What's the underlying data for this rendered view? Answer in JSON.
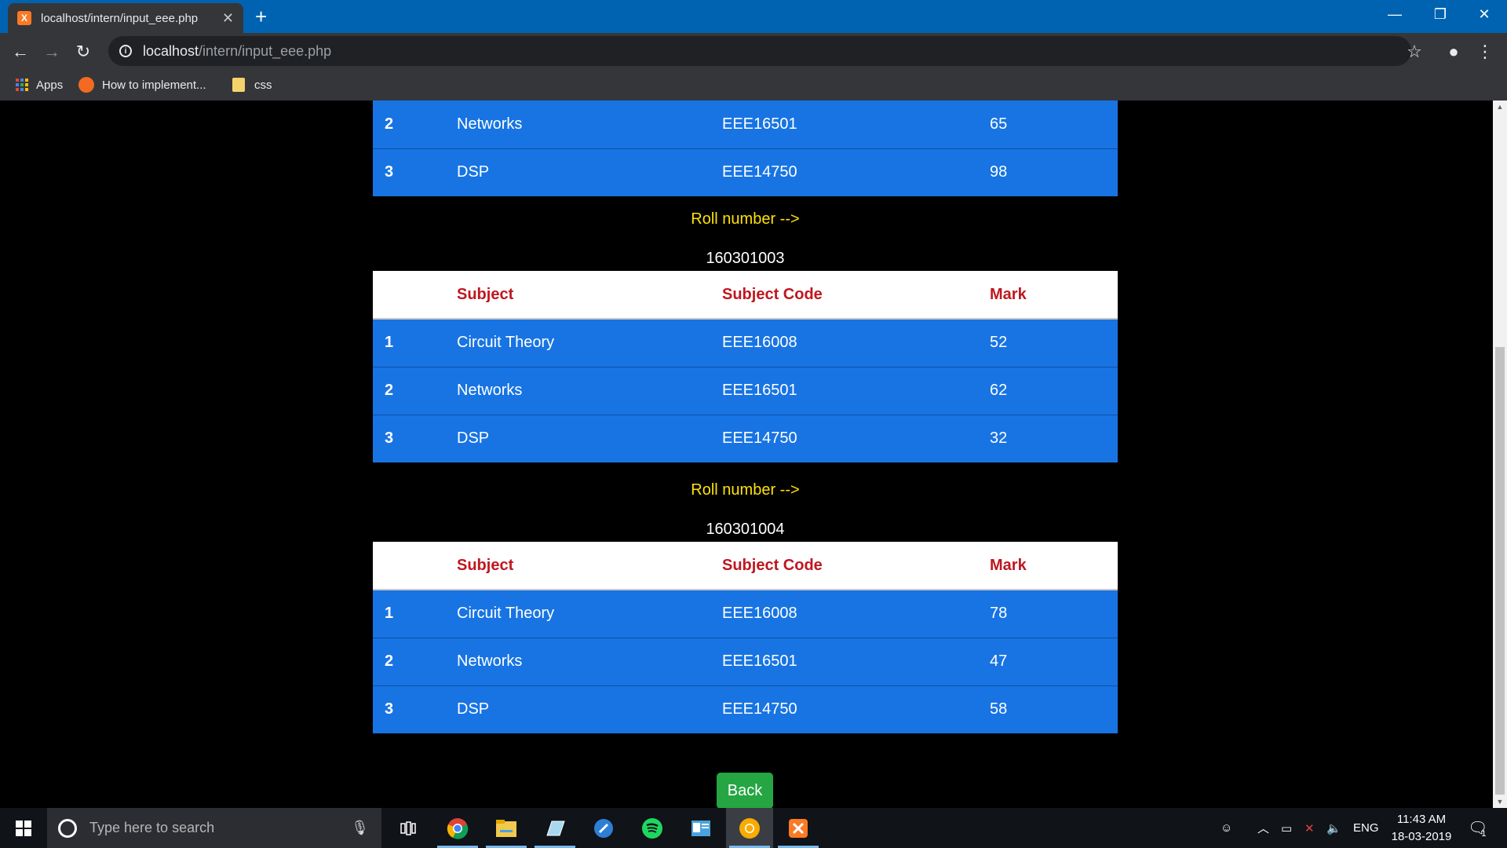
{
  "browser": {
    "tab_title": "localhost/intern/input_eee.php",
    "tab_favicon": "X",
    "url_host": "localhost",
    "url_path": "/intern/input_eee.php",
    "bookmarks": [
      {
        "label": "Apps"
      },
      {
        "label": "How to implement..."
      },
      {
        "label": "css"
      }
    ]
  },
  "page": {
    "tables": [
      {
        "rows": [
          {
            "no": "2",
            "subject": "Networks",
            "code": "EEE16501",
            "mark": "65"
          },
          {
            "no": "3",
            "subject": "DSP",
            "code": "EEE14750",
            "mark": "98"
          }
        ]
      },
      {
        "roll_label": "Roll number -->",
        "roll_number": "160301003",
        "headers": {
          "no": "",
          "subject": "Subject",
          "code": "Subject Code",
          "mark": "Mark"
        },
        "rows": [
          {
            "no": "1",
            "subject": "Circuit Theory",
            "code": "EEE16008",
            "mark": "52"
          },
          {
            "no": "2",
            "subject": "Networks",
            "code": "EEE16501",
            "mark": "62"
          },
          {
            "no": "3",
            "subject": "DSP",
            "code": "EEE14750",
            "mark": "32"
          }
        ]
      },
      {
        "roll_label": "Roll number -->",
        "roll_number": "160301004",
        "headers": {
          "no": "",
          "subject": "Subject",
          "code": "Subject Code",
          "mark": "Mark"
        },
        "rows": [
          {
            "no": "1",
            "subject": "Circuit Theory",
            "code": "EEE16008",
            "mark": "78"
          },
          {
            "no": "2",
            "subject": "Networks",
            "code": "EEE16501",
            "mark": "47"
          },
          {
            "no": "3",
            "subject": "DSP",
            "code": "EEE14750",
            "mark": "58"
          }
        ]
      }
    ],
    "back_label": "Back"
  },
  "taskbar": {
    "search_placeholder": "Type here to search",
    "language": "ENG",
    "time": "11:43 AM",
    "date": "18-03-2019",
    "notification_count": "1"
  },
  "colors": {
    "row_blue": "#1874e3",
    "header_red": "#c0161f",
    "roll_label_yellow": "#ffe10a",
    "back_green": "#26a543"
  }
}
